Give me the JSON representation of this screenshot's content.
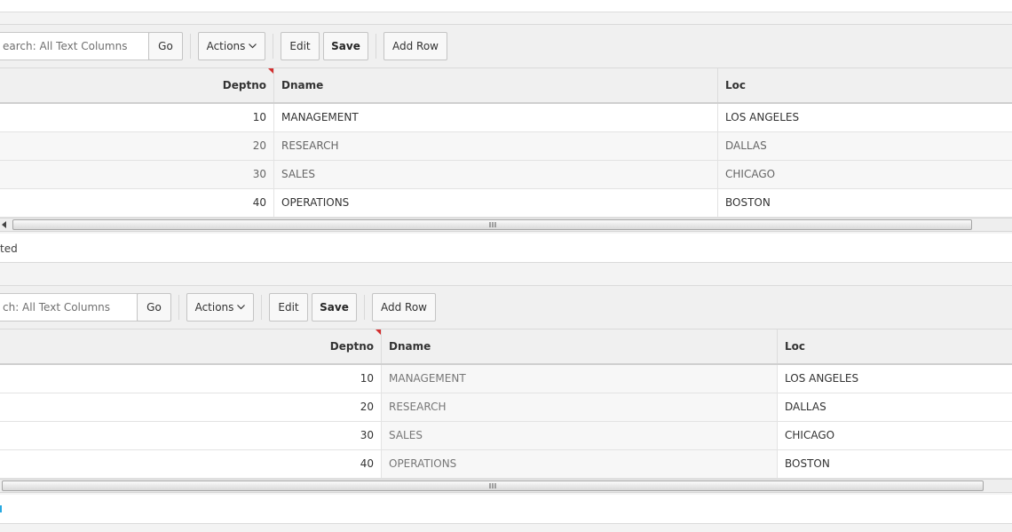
{
  "grid1": {
    "search_placeholder": "earch: All Text Columns",
    "go_label": "Go",
    "actions_label": "Actions",
    "edit_label": "Edit",
    "save_label": "Save",
    "add_row_label": "Add Row",
    "columns": [
      "Deptno",
      "Dname",
      "Loc"
    ],
    "rows": [
      {
        "deptno": "10",
        "dname": "MANAGEMENT",
        "loc": "LOS ANGELES"
      },
      {
        "deptno": "20",
        "dname": "RESEARCH",
        "loc": "DALLAS"
      },
      {
        "deptno": "30",
        "dname": "SALES",
        "loc": "CHICAGO"
      },
      {
        "deptno": "40",
        "dname": "OPERATIONS",
        "loc": "BOSTON"
      }
    ],
    "footer_text": "ted"
  },
  "grid2": {
    "search_placeholder": "ch: All Text Columns",
    "go_label": "Go",
    "actions_label": "Actions",
    "edit_label": "Edit",
    "save_label": "Save",
    "add_row_label": "Add Row",
    "columns": [
      "Deptno",
      "Dname",
      "Loc"
    ],
    "rows": [
      {
        "deptno": "10",
        "dname": "MANAGEMENT",
        "loc": "LOS ANGELES"
      },
      {
        "deptno": "20",
        "dname": "RESEARCH",
        "loc": "DALLAS"
      },
      {
        "deptno": "30",
        "dname": "SALES",
        "loc": "CHICAGO"
      },
      {
        "deptno": "40",
        "dname": "OPERATIONS",
        "loc": "BOSTON"
      }
    ]
  },
  "icons": {
    "actions_menu": "chevron-down-icon",
    "scroll_left": "arrow-left-icon",
    "scroll_thumb": "grip-icon",
    "column_changed": "red-corner-icon"
  },
  "colors": {
    "changed_marker": "#d32f2f",
    "focus_marker": "#27a9e1"
  }
}
